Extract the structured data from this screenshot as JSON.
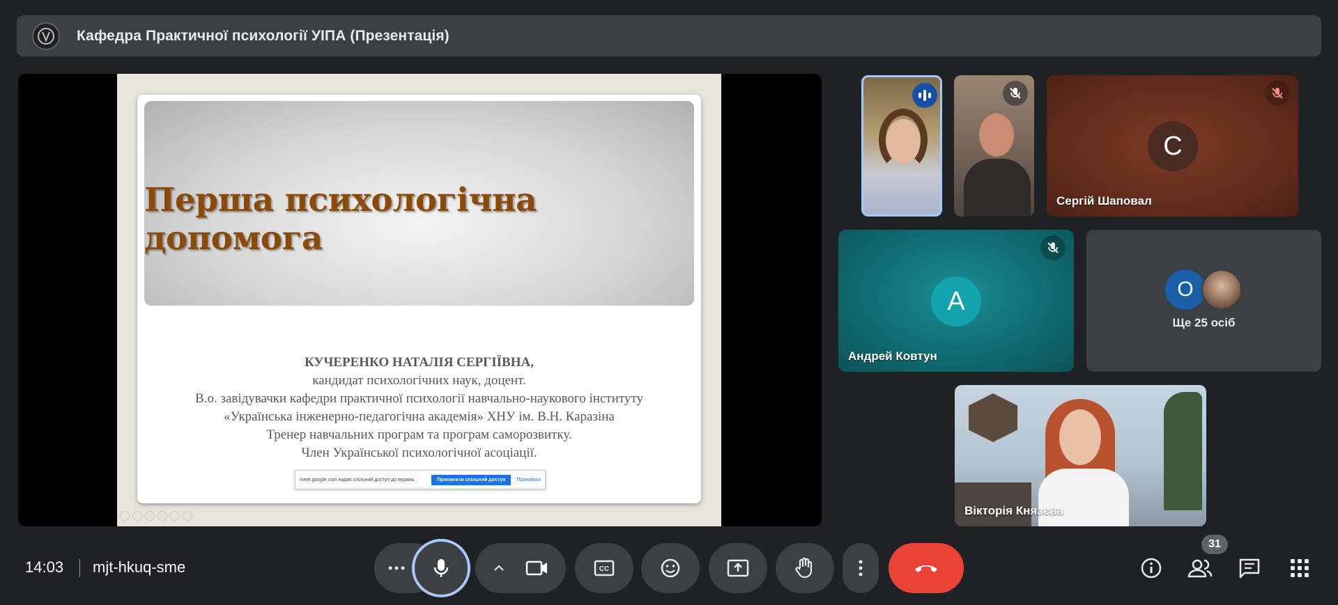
{
  "presentation": {
    "title": "Кафедра Практичної психології УІПА (Презентація)"
  },
  "slide": {
    "title": "Перша психологічна допомога",
    "lines": [
      "КУЧЕРЕНКО НАТАЛІЯ СЕРГІЇВНА,",
      "кандидат психологічних наук, доцент.",
      "В.о. завідувачки кафедри практичної психології навчально-наукового інституту",
      "«Українська інженерно-педагогічна академія» ХНУ ім. В.Н. Каразіна",
      "Тренер навчальних програм та програм саморозвитку.",
      "Член Української психологічної асоціації."
    ],
    "share_notice": {
      "text": "meet.google.com надає спільний доступ до екрана.",
      "stop": "Припинити спільний доступ",
      "hide": "Приховати"
    }
  },
  "participants": [
    {
      "name": "",
      "speaking": true
    },
    {
      "name": "",
      "muted": true
    },
    {
      "name": "Сергій Шаповал",
      "initial": "С",
      "muted": true
    },
    {
      "name": "Андрей Ковтун",
      "initial": "А",
      "muted": true
    },
    {
      "name": "Ще 25 осіб",
      "initial": "О"
    },
    {
      "name": "Вікторія Князєва"
    }
  ],
  "toolbar": {
    "time": "14:03",
    "meeting_code": "mjt-hkuq-sme",
    "participants_count": "31"
  },
  "colors": {
    "background": "#202124",
    "button": "#3c4043",
    "end_call": "#ea4335",
    "mic_ring": "#a8c7fa"
  }
}
